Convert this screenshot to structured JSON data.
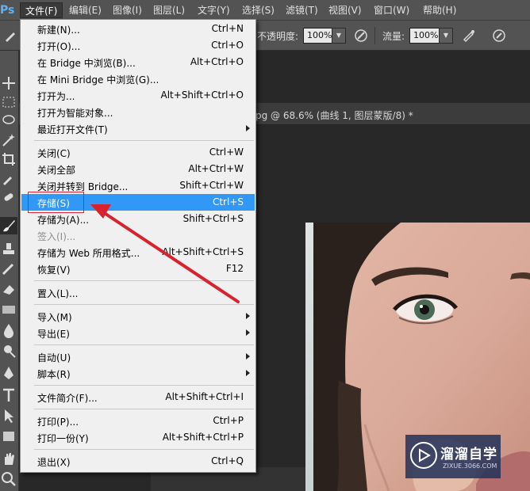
{
  "menubar": {
    "logo": "Ps",
    "items": [
      "文件(F)",
      "编辑(E)",
      "图像(I)",
      "图层(L)",
      "文字(Y)",
      "选择(S)",
      "滤镜(T)",
      "视图(V)",
      "窗口(W)",
      "帮助(H)"
    ]
  },
  "options": {
    "opacity_label": "不透明度:",
    "opacity_value": "100%",
    "flow_label": "流量:",
    "flow_value": "100%"
  },
  "document": {
    "tab_title": "pg @ 68.6% (曲线 1, 图层蒙版/8) *"
  },
  "file_menu": {
    "items": [
      {
        "label": "新建(N)...",
        "shortcut": "Ctrl+N"
      },
      {
        "label": "打开(O)...",
        "shortcut": "Ctrl+O"
      },
      {
        "label": "在 Bridge 中浏览(B)...",
        "shortcut": "Alt+Ctrl+O"
      },
      {
        "label": "在 Mini Bridge 中浏览(G)...",
        "shortcut": ""
      },
      {
        "label": "打开为...",
        "shortcut": "Alt+Shift+Ctrl+O"
      },
      {
        "label": "打开为智能对象...",
        "shortcut": ""
      },
      {
        "label": "最近打开文件(T)",
        "shortcut": ""
      },
      {
        "label": "关闭(C)",
        "shortcut": "Ctrl+W"
      },
      {
        "label": "关闭全部",
        "shortcut": "Alt+Ctrl+W"
      },
      {
        "label": "关闭并转到 Bridge...",
        "shortcut": "Shift+Ctrl+W"
      },
      {
        "label": "存储(S)",
        "shortcut": "Ctrl+S"
      },
      {
        "label": "存储为(A)...",
        "shortcut": "Shift+Ctrl+S"
      },
      {
        "label": "签入(I)...",
        "shortcut": ""
      },
      {
        "label": "存储为 Web 所用格式...",
        "shortcut": "Alt+Shift+Ctrl+S"
      },
      {
        "label": "恢复(V)",
        "shortcut": "F12"
      },
      {
        "label": "置入(L)...",
        "shortcut": ""
      },
      {
        "label": "导入(M)",
        "shortcut": ""
      },
      {
        "label": "导出(E)",
        "shortcut": ""
      },
      {
        "label": "自动(U)",
        "shortcut": ""
      },
      {
        "label": "脚本(R)",
        "shortcut": ""
      },
      {
        "label": "文件简介(F)...",
        "shortcut": "Alt+Shift+Ctrl+I"
      },
      {
        "label": "打印(P)...",
        "shortcut": "Ctrl+P"
      },
      {
        "label": "打印一份(Y)",
        "shortcut": "Alt+Shift+Ctrl+P"
      },
      {
        "label": "退出(X)",
        "shortcut": "Ctrl+Q"
      }
    ]
  },
  "watermark": {
    "brand": "溜溜自学",
    "url": "ZIXUE.3066.COM"
  },
  "colors": {
    "menu_highlight": "#3198f6",
    "annotation_red": "#d8232e",
    "ui_dark": "#535353"
  }
}
